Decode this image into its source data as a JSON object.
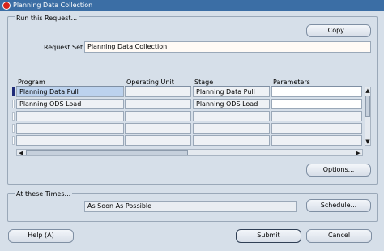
{
  "window": {
    "title": "Planning Data Collection"
  },
  "run_section": {
    "label": "Run this Request...",
    "copy_button": "Copy...",
    "request_set_label": "Request Set",
    "request_set_value": "Planning Data Collection"
  },
  "table": {
    "columns": [
      "Program",
      "Operating Unit",
      "Stage",
      "Parameters"
    ],
    "rows": [
      {
        "program": "Planning Data Pull",
        "operating_unit": "",
        "stage": "Planning Data Pull",
        "parameters": ""
      },
      {
        "program": "Planning ODS Load",
        "operating_unit": "",
        "stage": "Planning ODS Load",
        "parameters": ""
      },
      {
        "program": "",
        "operating_unit": "",
        "stage": "",
        "parameters": ""
      },
      {
        "program": "",
        "operating_unit": "",
        "stage": "",
        "parameters": ""
      },
      {
        "program": "",
        "operating_unit": "",
        "stage": "",
        "parameters": ""
      },
      {
        "program": "",
        "operating_unit": "",
        "stage": "",
        "parameters": ""
      }
    ]
  },
  "options_button": "Options...",
  "times_section": {
    "label": "At these Times...",
    "schedule_value": "As Soon As Possible",
    "schedule_button": "Schedule..."
  },
  "footer": {
    "help_button": "Help (A)",
    "submit_button": "Submit",
    "cancel_button": "Cancel"
  },
  "colors": {
    "titlebar": "#3b6ea5",
    "background": "#d6dfe9",
    "selected_cell": "#bcd2ee"
  },
  "icons": {
    "window_icon": "oracle-icon"
  }
}
